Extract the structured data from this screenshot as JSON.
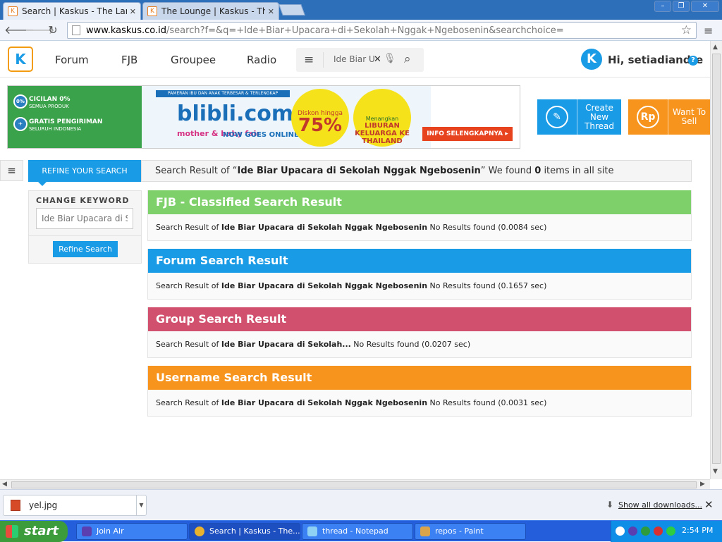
{
  "browser": {
    "tabs": [
      {
        "label": "Search | Kaskus - The Larges",
        "active": true
      },
      {
        "label": "The Lounge | Kaskus - The L",
        "active": false
      }
    ],
    "url_host": "www.kaskus.co.id",
    "url_path": "/search?f=&q=+Ide+Biar+Upacara+di+Sekolah+Nggak+Ngebosenin&searchchoice=",
    "window_buttons": [
      "–",
      "❐",
      "✕"
    ]
  },
  "header": {
    "logo": "K",
    "nav": [
      "Forum",
      "FJB",
      "Groupee",
      "Radio"
    ],
    "search_value": "Ide Biar Upacara di Sekolah Nggak Ngebosenin",
    "greeting": "Hi, setiadiandre",
    "help": "?"
  },
  "banner": {
    "row1_title": "CICILAN 0%",
    "row1_sub": "SEMUA PRODUK",
    "row1_icon": "0%",
    "row2_title": "GRATIS PENGIRIMAN",
    "row2_sub": "SELURUH INDONESIA",
    "strip": "PAMERAN IBU DAN ANAK TERBESAR & TERLENGKAP",
    "brand": "blibli.com",
    "mom": "mother & baby fair",
    "nowgoes": "NOW GOES ONLINE!",
    "discount_label": "Diskon hingga",
    "discount_value": "75%",
    "prize_label": "Menangkan",
    "prize_value": "LIBURAN KELUARGA KE THAILAND",
    "info": "INFO SELENGKAPNYA ▸"
  },
  "cta": {
    "create": "Create New Thread",
    "sell": "Want To Sell",
    "sell_icon": "Rp"
  },
  "refine": {
    "tab": "REFINE YOUR SEARCH",
    "label": "CHANGE KEYWORD",
    "placeholder": "Ide Biar Upacara di Sekolah Nggak Ngebosenin",
    "button": "Refine Search"
  },
  "summary": {
    "prefix": "Search Result of “",
    "query": "Ide Biar Upacara di Sekolah Nggak Ngebosenin",
    "mid": "” We found ",
    "count": "0",
    "suffix": " items in all site"
  },
  "results": [
    {
      "title": "FJB - Classified Search Result",
      "color": "#7ed06a",
      "query": "Ide Biar Upacara di Sekolah Nggak Ngebosenin",
      "status": "  No Results found (0.0084 sec)"
    },
    {
      "title": "Forum Search Result",
      "color": "#1a9be6",
      "query": "Ide Biar Upacara di Sekolah Nggak Ngebosenin",
      "status": " No Results found (0.1657 sec)"
    },
    {
      "title": "Group Search Result",
      "color": "#d0506e",
      "query": "Ide Biar Upacara di Sekolah...",
      "status": " No Results found (0.0207 sec)"
    },
    {
      "title": "Username Search Result",
      "color": "#f7941d",
      "query": "Ide Biar Upacara di Sekolah Nggak Ngebosenin",
      "status": " No Results found (0.0031 sec)"
    }
  ],
  "result_prefix": "Search Result of ",
  "downloads": {
    "file": "yel.jpg",
    "show_all": "Show all downloads..."
  },
  "taskbar": {
    "start": "start",
    "tasks": [
      "Join Air",
      "Search | Kaskus - The...",
      "thread - Notepad",
      "repos - Paint"
    ],
    "clock": "2:54 PM"
  }
}
